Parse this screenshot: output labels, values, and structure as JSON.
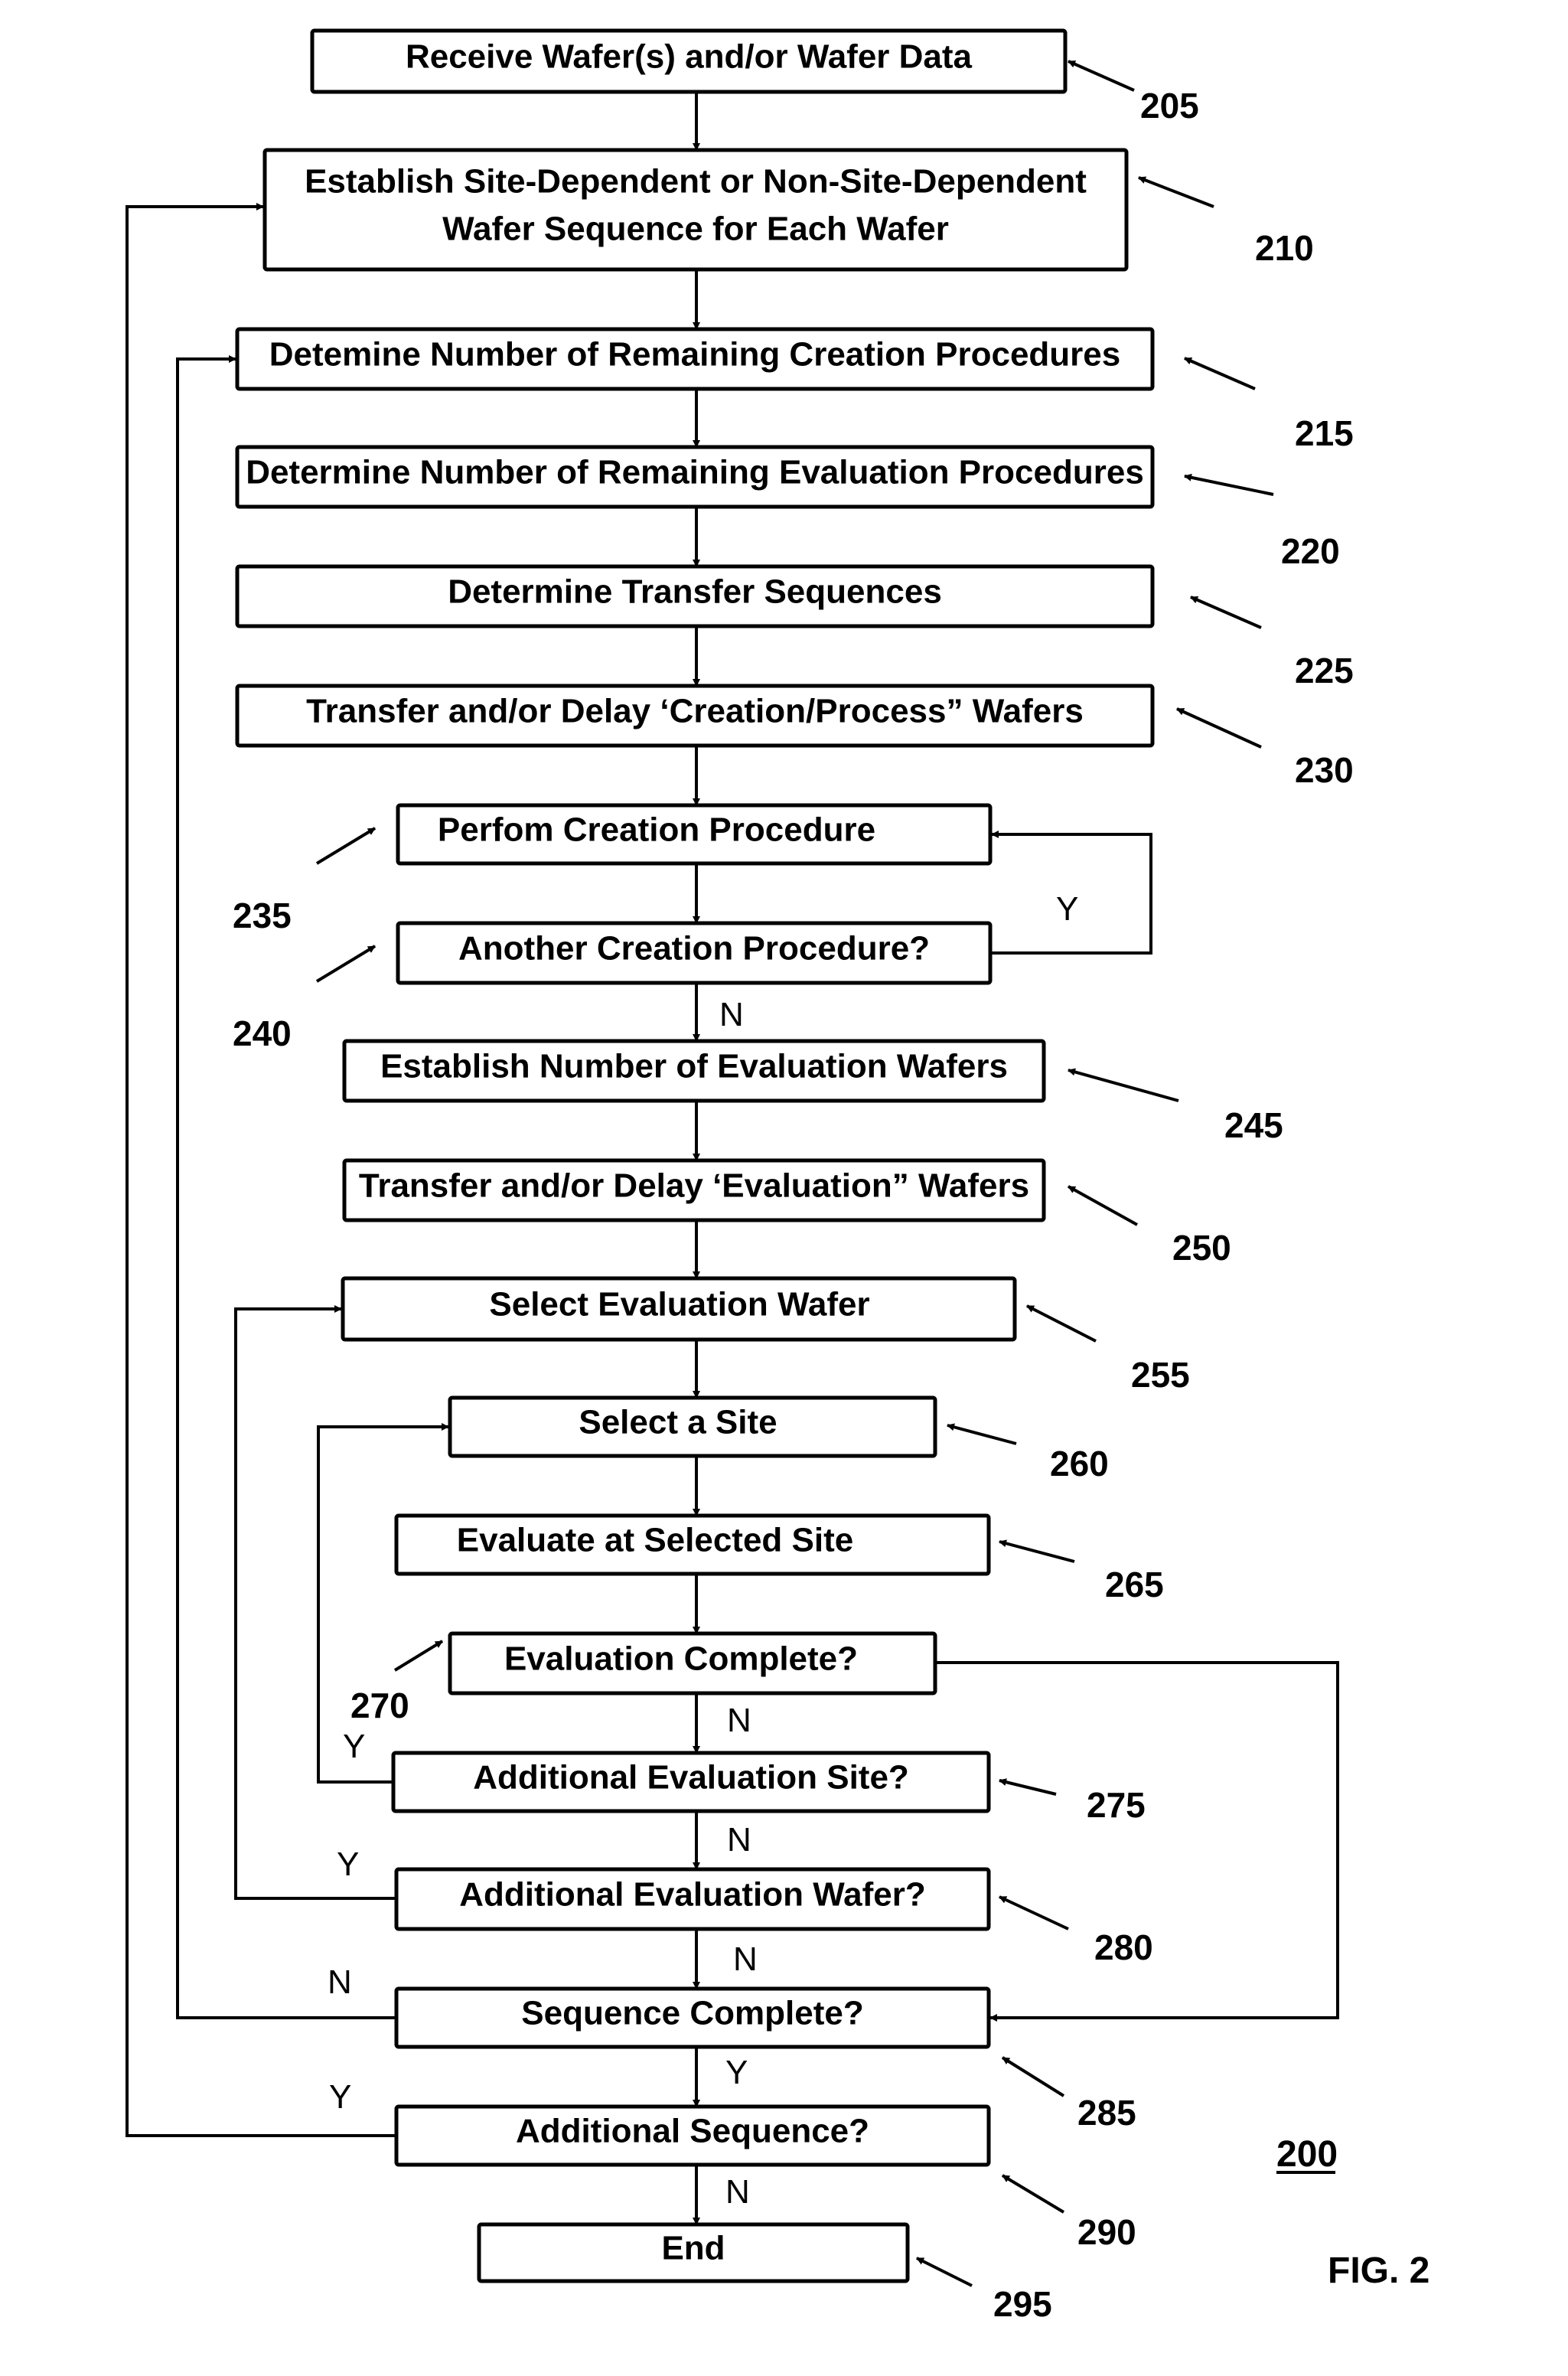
{
  "figure": {
    "label": "FIG. 2",
    "reference": "200"
  },
  "steps": [
    {
      "id": "205",
      "lines": [
        "Receive Wafer(s) and/or Wafer Data"
      ],
      "ref": "205"
    },
    {
      "id": "210",
      "lines": [
        "Establish Site-Dependent or Non-Site-Dependent",
        "Wafer Sequence for Each Wafer"
      ],
      "ref": "210"
    },
    {
      "id": "215",
      "lines": [
        "Detemine Number of Remaining Creation Procedures"
      ],
      "ref": "215"
    },
    {
      "id": "220",
      "lines": [
        "Determine Number of Remaining Evaluation Procedures"
      ],
      "ref": "220"
    },
    {
      "id": "225",
      "lines": [
        "Determine Transfer Sequences"
      ],
      "ref": "225"
    },
    {
      "id": "230",
      "lines": [
        "Transfer and/or Delay ‘Creation/Process” Wafers"
      ],
      "ref": "230"
    },
    {
      "id": "235",
      "lines": [
        "Perfom Creation Procedure"
      ],
      "ref": "235"
    },
    {
      "id": "240",
      "lines": [
        "Another Creation Procedure?"
      ],
      "ref": "240"
    },
    {
      "id": "245",
      "lines": [
        "Establish Number of Evaluation Wafers"
      ],
      "ref": "245"
    },
    {
      "id": "250",
      "lines": [
        "Transfer and/or Delay ‘Evaluation” Wafers"
      ],
      "ref": "250"
    },
    {
      "id": "255",
      "lines": [
        "Select Evaluation Wafer"
      ],
      "ref": "255"
    },
    {
      "id": "260",
      "lines": [
        "Select a Site"
      ],
      "ref": "260"
    },
    {
      "id": "265",
      "lines": [
        "Evaluate at Selected Site"
      ],
      "ref": "265"
    },
    {
      "id": "270",
      "lines": [
        "Evaluation Complete?"
      ],
      "ref": "270"
    },
    {
      "id": "275",
      "lines": [
        "Additional Evaluation Site?"
      ],
      "ref": "275"
    },
    {
      "id": "280",
      "lines": [
        "Additional Evaluation Wafer?"
      ],
      "ref": "280"
    },
    {
      "id": "285",
      "lines": [
        "Sequence Complete?"
      ],
      "ref": "285"
    },
    {
      "id": "290",
      "lines": [
        "Additional Sequence?"
      ],
      "ref": "290"
    },
    {
      "id": "295",
      "lines": [
        "End"
      ],
      "ref": "295"
    }
  ],
  "branch_labels": {
    "yes": "Y",
    "no": "N"
  },
  "connections": [
    {
      "from": "205",
      "to": "210"
    },
    {
      "from": "210",
      "to": "215"
    },
    {
      "from": "215",
      "to": "220"
    },
    {
      "from": "220",
      "to": "225"
    },
    {
      "from": "225",
      "to": "230"
    },
    {
      "from": "230",
      "to": "235"
    },
    {
      "from": "235",
      "to": "240"
    },
    {
      "from": "240",
      "to": "235",
      "label": "Y"
    },
    {
      "from": "240",
      "to": "245",
      "label": "N"
    },
    {
      "from": "245",
      "to": "250"
    },
    {
      "from": "250",
      "to": "255"
    },
    {
      "from": "255",
      "to": "260"
    },
    {
      "from": "260",
      "to": "265"
    },
    {
      "from": "265",
      "to": "270"
    },
    {
      "from": "270",
      "to": "275",
      "label": "N"
    },
    {
      "from": "270",
      "to": "285"
    },
    {
      "from": "275",
      "to": "260",
      "label": "Y"
    },
    {
      "from": "275",
      "to": "280",
      "label": "N"
    },
    {
      "from": "280",
      "to": "255",
      "label": "Y"
    },
    {
      "from": "280",
      "to": "285",
      "label": "N"
    },
    {
      "from": "285",
      "to": "215",
      "label": "N"
    },
    {
      "from": "285",
      "to": "290",
      "label": "Y"
    },
    {
      "from": "290",
      "to": "210",
      "label": "Y"
    },
    {
      "from": "290",
      "to": "295",
      "label": "N"
    }
  ]
}
